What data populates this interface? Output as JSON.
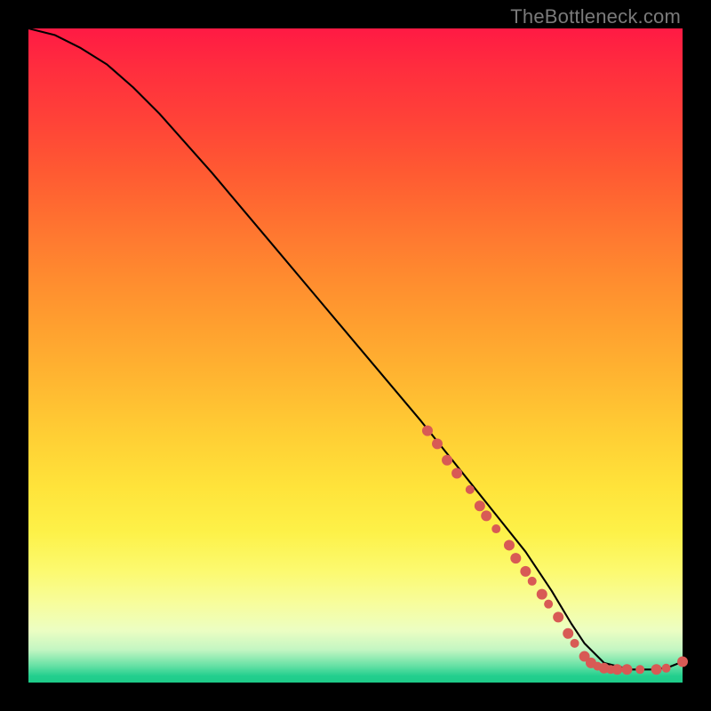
{
  "watermark": "TheBottleneck.com",
  "colors": {
    "dot": "#d85a55",
    "curve": "#000000",
    "page_bg": "#000000"
  },
  "chart_data": {
    "type": "line",
    "title": "",
    "xlabel": "",
    "ylabel": "",
    "xlim": [
      0,
      100
    ],
    "ylim": [
      0,
      100
    ],
    "grid": false,
    "legend": false,
    "series": [
      {
        "name": "curve",
        "x": [
          0,
          4,
          8,
          12,
          16,
          20,
          28,
          36,
          44,
          52,
          60,
          68,
          72,
          76,
          80,
          83,
          85,
          88,
          92,
          96,
          98,
          100
        ],
        "y": [
          100,
          99,
          97,
          94.5,
          91,
          87,
          78,
          68.5,
          59,
          49.5,
          40,
          30,
          25,
          20,
          14,
          9,
          6,
          3,
          2,
          2,
          2.4,
          3.2
        ]
      }
    ],
    "markers": [
      {
        "x": 61.0,
        "y": 38.5,
        "r": 6
      },
      {
        "x": 62.5,
        "y": 36.5,
        "r": 6
      },
      {
        "x": 64.0,
        "y": 34.0,
        "r": 6
      },
      {
        "x": 65.5,
        "y": 32.0,
        "r": 6
      },
      {
        "x": 67.5,
        "y": 29.5,
        "r": 5
      },
      {
        "x": 69.0,
        "y": 27.0,
        "r": 6
      },
      {
        "x": 70.0,
        "y": 25.5,
        "r": 6
      },
      {
        "x": 71.5,
        "y": 23.5,
        "r": 5
      },
      {
        "x": 73.5,
        "y": 21.0,
        "r": 6
      },
      {
        "x": 74.5,
        "y": 19.0,
        "r": 6
      },
      {
        "x": 76.0,
        "y": 17.0,
        "r": 6
      },
      {
        "x": 77.0,
        "y": 15.5,
        "r": 5
      },
      {
        "x": 78.5,
        "y": 13.5,
        "r": 6
      },
      {
        "x": 79.5,
        "y": 12.0,
        "r": 5
      },
      {
        "x": 81.0,
        "y": 10.0,
        "r": 6
      },
      {
        "x": 82.5,
        "y": 7.5,
        "r": 6
      },
      {
        "x": 83.5,
        "y": 6.0,
        "r": 5
      },
      {
        "x": 85.0,
        "y": 4.0,
        "r": 6
      },
      {
        "x": 86.0,
        "y": 3.0,
        "r": 6
      },
      {
        "x": 87.0,
        "y": 2.5,
        "r": 5
      },
      {
        "x": 88.0,
        "y": 2.2,
        "r": 6
      },
      {
        "x": 89.0,
        "y": 2.0,
        "r": 5
      },
      {
        "x": 90.0,
        "y": 2.0,
        "r": 6
      },
      {
        "x": 91.5,
        "y": 2.0,
        "r": 6
      },
      {
        "x": 93.5,
        "y": 2.0,
        "r": 5
      },
      {
        "x": 96.0,
        "y": 2.0,
        "r": 6
      },
      {
        "x": 97.5,
        "y": 2.2,
        "r": 5
      },
      {
        "x": 100.0,
        "y": 3.2,
        "r": 6
      }
    ]
  }
}
